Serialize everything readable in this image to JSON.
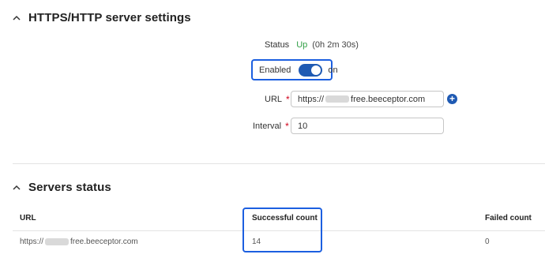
{
  "settings_section": {
    "title": "HTTPS/HTTP server settings",
    "status_label": "Status",
    "status_value": "Up",
    "status_uptime": "(0h 2m 30s)",
    "enabled_label": "Enabled",
    "enabled_state": "on",
    "url_label": "URL",
    "url_required": "*",
    "url_prefix": "https://",
    "url_suffix": "free.beeceptor.com",
    "interval_label": "Interval",
    "interval_required": "*",
    "interval_value": "10",
    "add_button": "+"
  },
  "servers_section": {
    "title": "Servers status",
    "columns": [
      "URL",
      "Successful count",
      "Failed count"
    ],
    "rows": [
      {
        "url_prefix": "https://",
        "url_suffix": "free.beeceptor.com",
        "successful": "14",
        "failed": "0"
      }
    ]
  },
  "colors": {
    "accent": "#1f5ab3",
    "highlight_border": "#1c5fe0",
    "status_up": "#2f9e44",
    "required": "#d0021b"
  }
}
